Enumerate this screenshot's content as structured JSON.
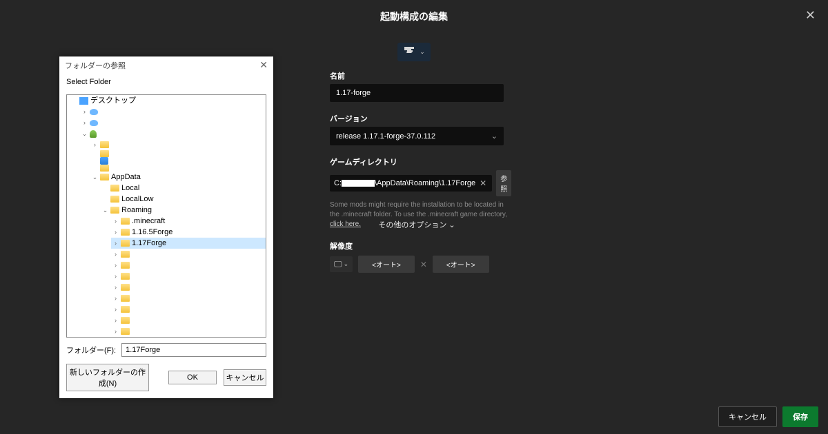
{
  "page": {
    "title": "起動構成の編集"
  },
  "form": {
    "name_label": "名前",
    "name_value": "1.17-forge",
    "version_label": "バージョン",
    "version_value": "release 1.17.1-forge-37.0.112",
    "dir_label": "ゲームディレクトリ",
    "dir_prefix": "C:",
    "dir_suffix": "\\AppData\\Roaming\\1.17Forge",
    "browse_label": "参照",
    "help_text": "Some mods might require the installation to be located in the .minecraft folder. To use the .minecraft game directory, ",
    "help_link": "click here.",
    "resolution_label": "解像度",
    "auto_label": "<オート>",
    "more_options": "その他のオプション"
  },
  "footer": {
    "cancel": "キャンセル",
    "save": "保存"
  },
  "folder_dialog": {
    "title": "フォルダーの参照",
    "instruction": "Select Folder",
    "name_prefix": "フォルダー(F):",
    "name_value": "1.17Forge",
    "new_folder": "新しいフォルダーの作成(N)",
    "ok": "OK",
    "cancel": "キャンセル",
    "tree": {
      "desktop": "デスクトップ",
      "appdata": "AppData",
      "local": "Local",
      "locallow": "LocalLow",
      "roaming": "Roaming",
      "minecraft": ".minecraft",
      "f1165": "1.16.5Forge",
      "f117": "1.17Forge"
    }
  }
}
